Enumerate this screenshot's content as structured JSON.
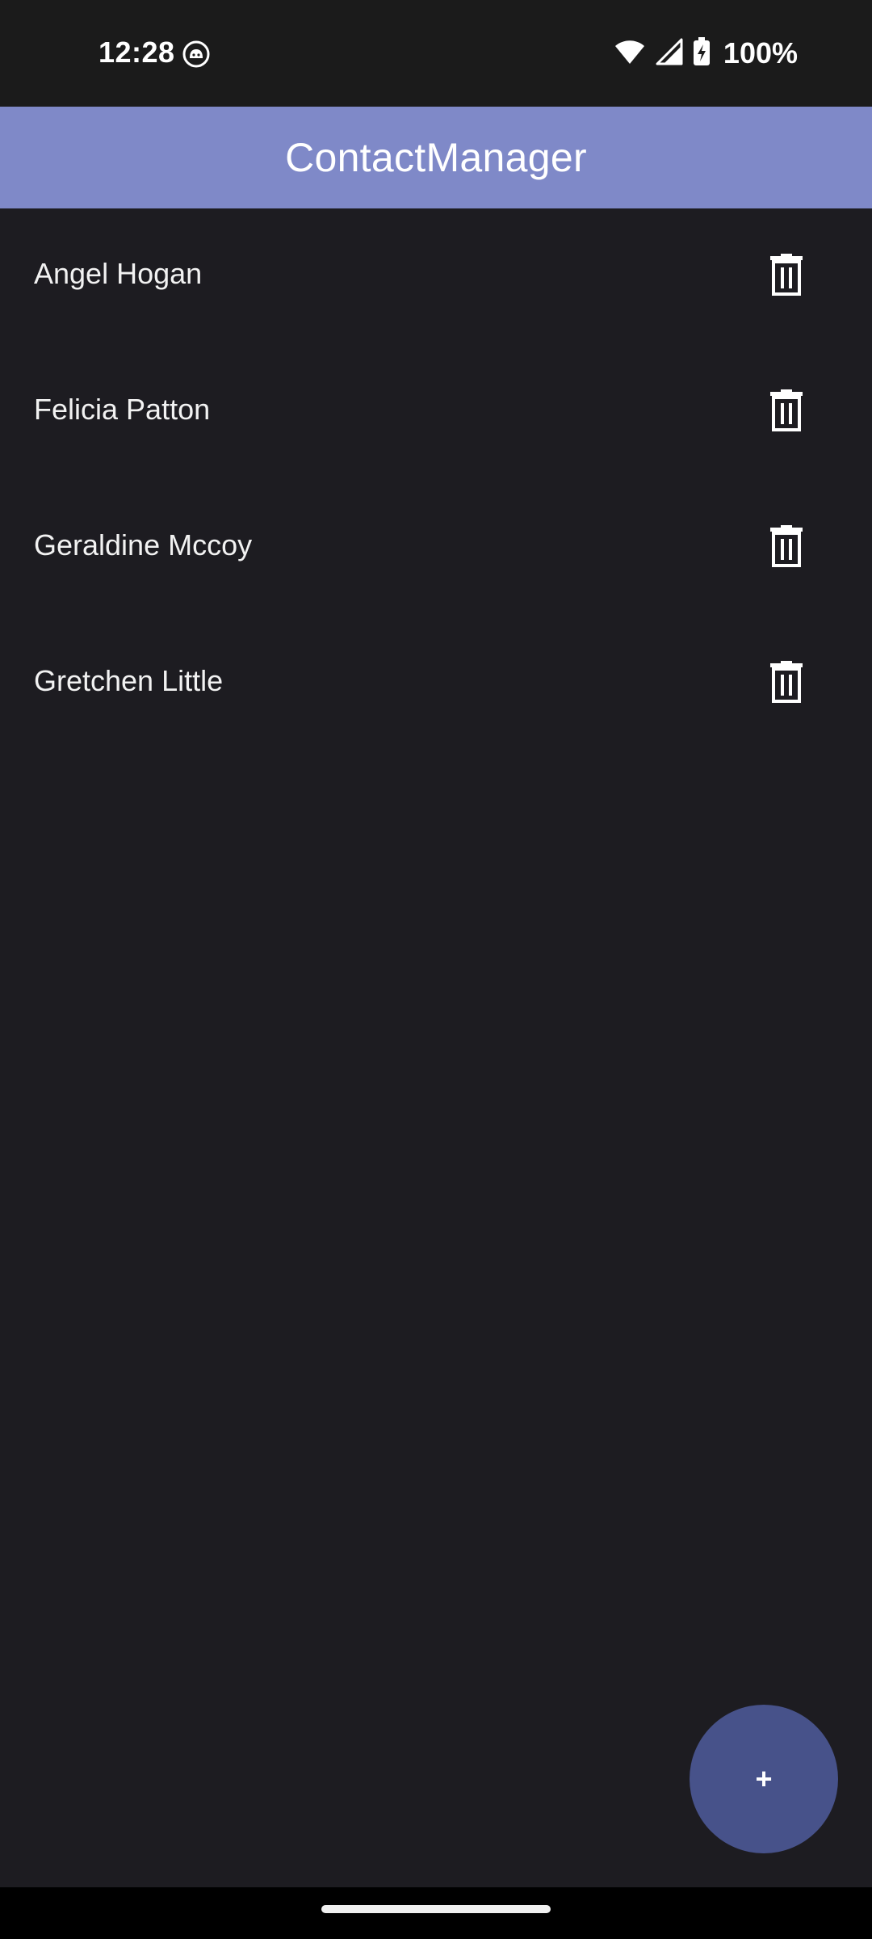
{
  "status_bar": {
    "time": "12:28",
    "battery": "100%",
    "icons": [
      "cat-app-icon",
      "wifi-icon",
      "signal-icon",
      "battery-charging-icon"
    ]
  },
  "app_bar": {
    "title": "ContactManager",
    "color": "#7f89c8"
  },
  "contacts": [
    {
      "name": "Angel Hogan",
      "action_icon": "trash-icon"
    },
    {
      "name": "Felicia Patton",
      "action_icon": "trash-icon"
    },
    {
      "name": "Geraldine Mccoy",
      "action_icon": "trash-icon"
    },
    {
      "name": "Gretchen Little",
      "action_icon": "trash-icon"
    }
  ],
  "fab": {
    "label": "+",
    "icon": "add-icon",
    "color": "#47528a"
  },
  "colors": {
    "background": "#1d1c21",
    "status_bar": "#1b1b1b",
    "nav_bar": "#000000"
  }
}
